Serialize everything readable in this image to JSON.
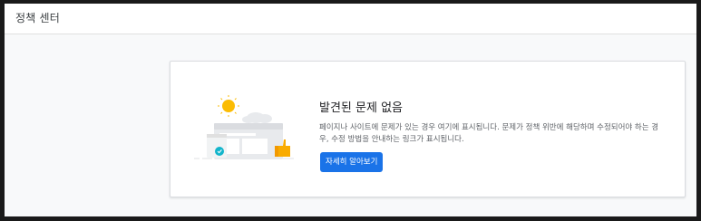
{
  "header": {
    "title": "정책 센터"
  },
  "card": {
    "title": "발견된 문제 없음",
    "description": "페이지나 사이트에 문제가 있는 경우 여기에 표시됩니다. 문제가 정책 위반에 해당하며 수정되어야 하는 경우, 수정 방법을 안내하는 링크가 표시됩니다.",
    "learn_more_label": "자세히 알아보기",
    "illustration": {
      "icons": [
        "sun-icon",
        "cloud-icon",
        "browser-window-icon",
        "thumbs-up-icon",
        "shield-check-icon"
      ]
    }
  },
  "colors": {
    "accent": "#1a73e8",
    "sun": "#fbbc04",
    "thumbs_up": "#f9ab00",
    "shield": "#12b5cb",
    "title_text": "#202124",
    "body_text": "#5f6368"
  }
}
